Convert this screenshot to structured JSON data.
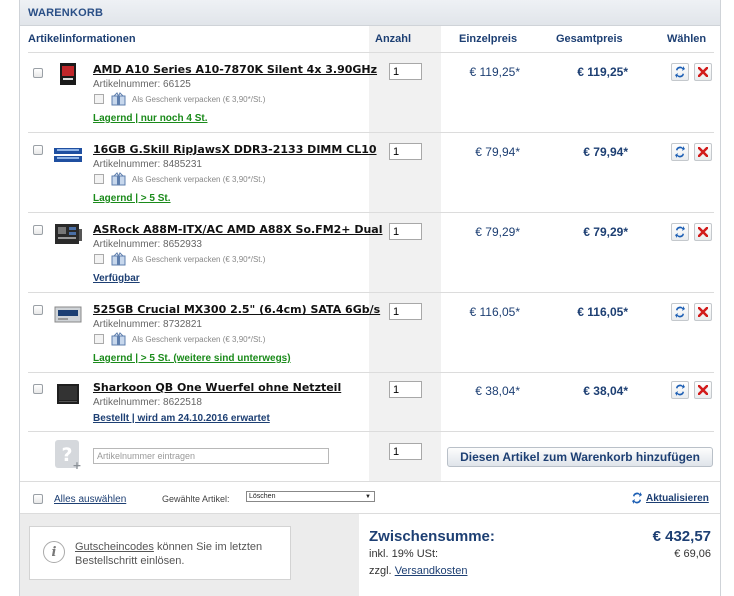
{
  "panel": {
    "title": "WARENKORB"
  },
  "columns": {
    "info": "Artikelinformationen",
    "qty": "Anzahl",
    "unit": "Einzelpreis",
    "total": "Gesamtpreis",
    "choose": "Wählen"
  },
  "items": [
    {
      "name": "AMD A10 Series A10-7870K Silent 4x 3.90GHz",
      "artnr": "Artikelnummer: 66125",
      "gift": "Als Geschenk verpacken (€ 3,90*/St.)",
      "status": "Lagernd | nur noch 4 St.",
      "qty": "1",
      "unit_price": "€ 119,25*",
      "total_price": "€ 119,25*",
      "thumb": "cpu-box-icon"
    },
    {
      "name": "16GB G.Skill RipJawsX DDR3-2133 DIMM CL10",
      "artnr": "Artikelnummer: 8485231",
      "gift": "Als Geschenk verpacken (€ 3,90*/St.)",
      "status": "Lagernd | > 5 St.",
      "qty": "1",
      "unit_price": "€ 79,94*",
      "total_price": "€ 79,94*",
      "thumb": "ram-module-icon"
    },
    {
      "name": "ASRock A88M-ITX/AC AMD A88X So.FM2+ Dual",
      "artnr": "Artikelnummer: 8652933",
      "gift": "Als Geschenk verpacken (€ 3,90*/St.)",
      "status": "Verfügbar",
      "qty": "1",
      "unit_price": "€ 79,29*",
      "total_price": "€ 79,29*",
      "thumb": "motherboard-icon"
    },
    {
      "name": "525GB Crucial MX300 2.5\" (6.4cm) SATA 6Gb/s",
      "artnr": "Artikelnummer: 8732821",
      "gift": "Als Geschenk verpacken (€ 3,90*/St.)",
      "status": "Lagernd | > 5 St. (weitere sind unterwegs)",
      "qty": "1",
      "unit_price": "€ 116,05*",
      "total_price": "€ 116,05*",
      "thumb": "ssd-icon"
    },
    {
      "name": "Sharkoon QB One Wuerfel ohne Netzteil",
      "artnr": "Artikelnummer: 8622518",
      "gift": "",
      "status": "Bestellt | wird am 24.10.2016 erwartet",
      "qty": "1",
      "unit_price": "€ 38,04*",
      "total_price": "€ 38,04*",
      "thumb": "pc-case-icon"
    }
  ],
  "add_row": {
    "placeholder": "Artikelnummer eintragen",
    "qty": "1",
    "button": "Diesen Artikel zum Warenkorb hinzufügen"
  },
  "footer": {
    "select_all": "Alles auswählen",
    "selected_label": "Gewählte Artikel:",
    "selected_action": "Löschen",
    "refresh": "Aktualisieren"
  },
  "coupon": {
    "link": "Gutscheincodes",
    "text": " können Sie im letzten Bestellschritt einlösen."
  },
  "summary": {
    "subtotal_label": "Zwischensumme:",
    "subtotal_value": "€ 432,57",
    "tax_label": "inkl. 19% USt:",
    "tax_value": "€ 69,06",
    "shipping_prefix": "zzgl. ",
    "shipping_link": "Versandkosten"
  },
  "colors": {
    "accent": "#1d3f73",
    "stock_green": "#1a8a1a",
    "delete_red": "#d21b1b"
  }
}
